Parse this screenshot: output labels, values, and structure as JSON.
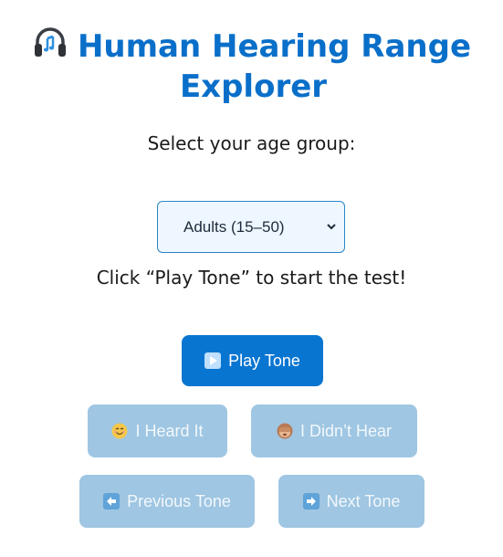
{
  "header": {
    "title_line1": "Human Hearing Range",
    "title_line2": "Explorer",
    "icon": "headphones-icon"
  },
  "age": {
    "prompt": "Select your age group:",
    "selected": "Adults (15–50)"
  },
  "status_text": "Click “Play Tone” to start the test!",
  "buttons": {
    "play": "Play Tone",
    "heard": "I Heard It",
    "not_heard": "I Didn’t Hear",
    "previous": "Previous Tone",
    "next": "Next Tone"
  },
  "colors": {
    "accent": "#0875d1",
    "title": "#0a6fc9",
    "disabled": "#9fc6e2"
  }
}
